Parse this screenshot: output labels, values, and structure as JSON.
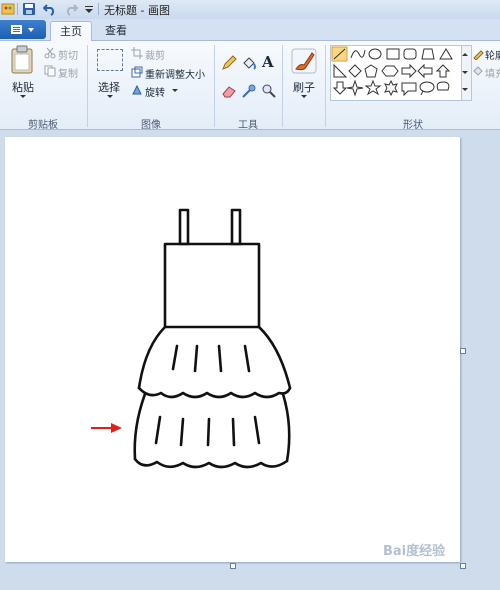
{
  "titlebar": {
    "title": "无标题 - 画图"
  },
  "tabs": {
    "home": "主页",
    "view": "查看"
  },
  "clipboard": {
    "paste": "粘贴",
    "cut": "剪切",
    "copy": "复制",
    "label": "剪贴板"
  },
  "image": {
    "select": "选择",
    "crop": "裁剪",
    "resize": "重新调整大小",
    "rotate": "旋转",
    "label": "图像"
  },
  "tools": {
    "text_tool": "A",
    "label": "工具"
  },
  "brushes": {
    "label": "刷子"
  },
  "shapes": {
    "label": "形状",
    "outline": "轮廓",
    "fill": "填充"
  },
  "watermark": "Bai度经验",
  "colors": {
    "accent": "#1f5fb0",
    "arrow": "#e0201a",
    "canvas": "#ffffff"
  }
}
